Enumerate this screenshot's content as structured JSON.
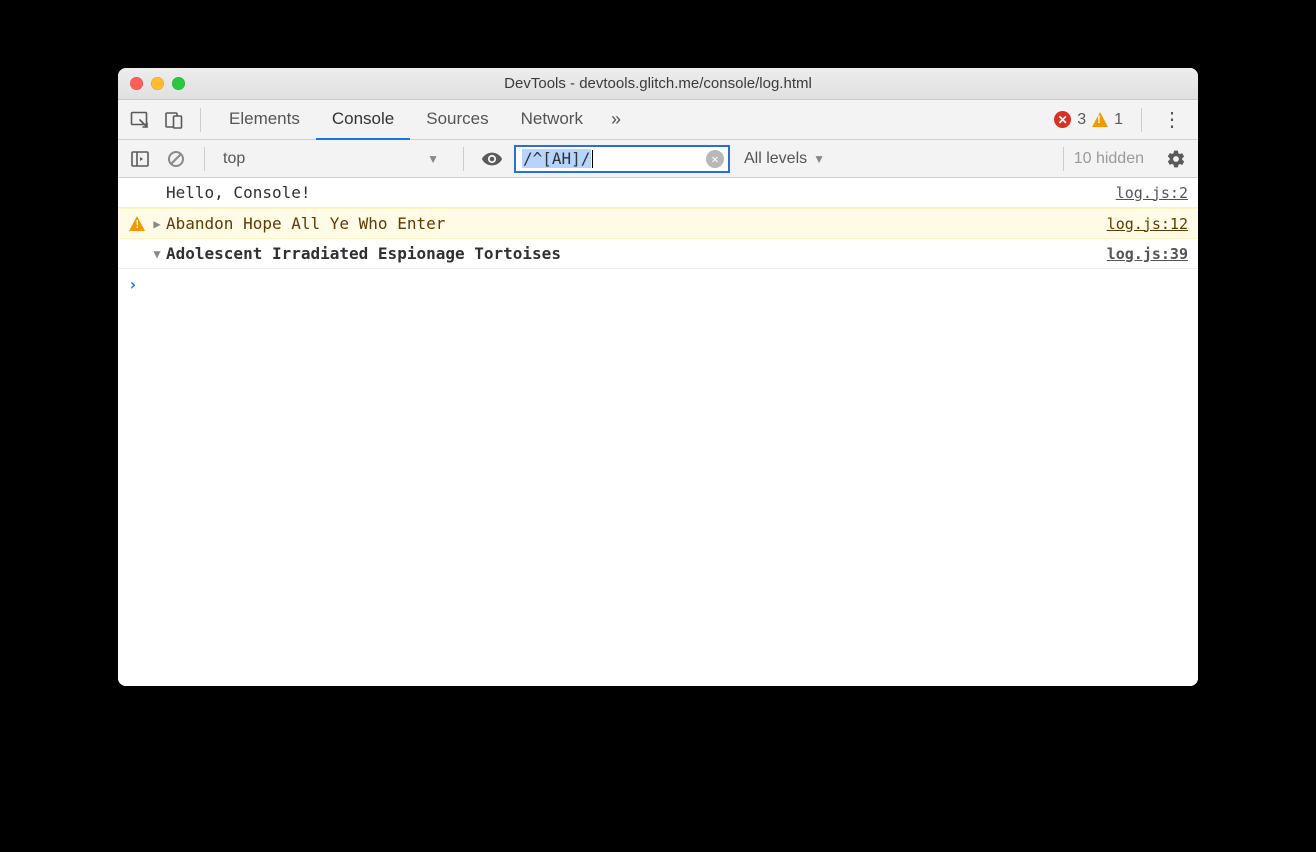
{
  "window": {
    "title": "DevTools - devtools.glitch.me/console/log.html"
  },
  "tabs": {
    "elements": "Elements",
    "console": "Console",
    "sources": "Sources",
    "network": "Network"
  },
  "status": {
    "error_count": "3",
    "warn_count": "1"
  },
  "toolbar": {
    "context": "top",
    "filter_value": "/^[AH]/",
    "levels": "All levels",
    "hidden": "10 hidden"
  },
  "messages": {
    "hello": {
      "text": "Hello, Console!",
      "src": "log.js:2"
    },
    "warn": {
      "text": "Abandon Hope All Ye Who Enter",
      "src": "log.js:12"
    },
    "group": {
      "text": "Adolescent Irradiated Espionage Tortoises",
      "src": "log.js:39"
    }
  }
}
